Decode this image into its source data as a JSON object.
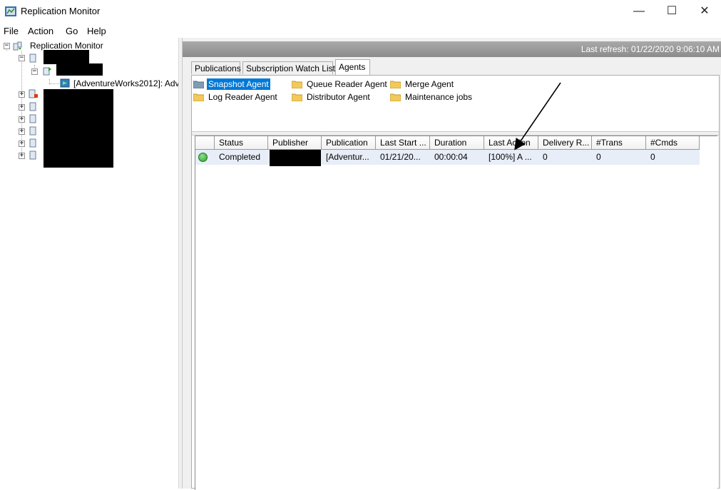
{
  "window": {
    "title": "Replication Monitor",
    "minimize": "—",
    "maximize": "☐",
    "close": "✕"
  },
  "menu": [
    "File",
    "Action",
    "Go",
    "Help"
  ],
  "tree": {
    "root_label": "Replication Monitor",
    "publication_label": "[AdventureWorks2012]: Adve"
  },
  "refresh": {
    "text": "Last refresh: 01/22/2020 9:06:10 AM"
  },
  "tabs": [
    "Publications",
    "Subscription Watch List",
    "Agents"
  ],
  "agents": [
    {
      "label": "Snapshot Agent",
      "selected": true
    },
    {
      "label": "Queue Reader Agent",
      "selected": false
    },
    {
      "label": "Merge Agent",
      "selected": false
    },
    {
      "label": "Log Reader Agent",
      "selected": false
    },
    {
      "label": "Distributor Agent",
      "selected": false
    },
    {
      "label": "Maintenance jobs",
      "selected": false
    }
  ],
  "grid": {
    "columns": [
      "",
      "Status",
      "Publisher",
      "Publication",
      "Last Start ...",
      "Duration",
      "Last Action",
      "Delivery R...",
      "#Trans",
      "#Cmds"
    ],
    "rows": [
      {
        "status": "Completed",
        "publisher": "",
        "publication": "[Adventur...",
        "last_start": "01/21/20...",
        "duration": "00:00:04",
        "last_action": "[100%] A ...",
        "delivery_rate": "0",
        "trans": "0",
        "cmds": "0"
      }
    ]
  },
  "colors": {
    "selection": "#0078d7",
    "row": "#e8eef7",
    "refresh_bar": "#9a9a9a"
  }
}
